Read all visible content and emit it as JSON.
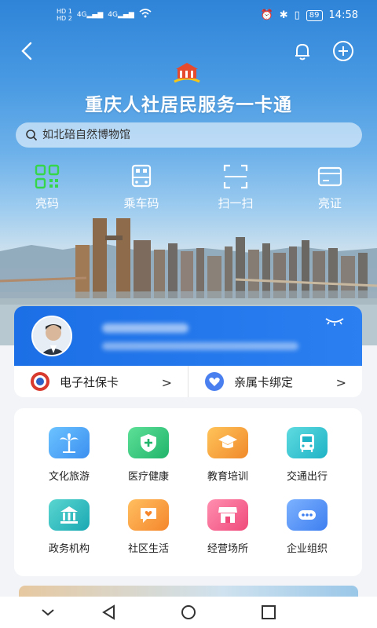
{
  "status_bar": {
    "hd1": "HD 1",
    "hd2": "HD 2",
    "signal1": "4G",
    "signal2": "4G",
    "battery": "89",
    "time": "14:58"
  },
  "header": {
    "title": "重庆人社居民服务一卡通"
  },
  "search": {
    "placeholder": "如北碚自然博物馆"
  },
  "quick_actions": [
    {
      "label": "亮码",
      "icon": "qr-code-icon"
    },
    {
      "label": "乘车码",
      "icon": "bus-code-icon"
    },
    {
      "label": "扫一扫",
      "icon": "scan-icon"
    },
    {
      "label": "亮证",
      "icon": "card-icon"
    }
  ],
  "card_links": [
    {
      "label": "电子社保卡",
      "icon": "social-security-emblem-icon"
    },
    {
      "label": "亲属卡绑定",
      "icon": "heart-icon"
    }
  ],
  "services": [
    {
      "label": "文化旅游",
      "icon": "palm-tree-icon",
      "color": "#4aa8f0"
    },
    {
      "label": "医疗健康",
      "icon": "medical-shield-icon",
      "color": "#36c27a"
    },
    {
      "label": "教育培训",
      "icon": "graduation-cap-icon",
      "color": "#f5a23a"
    },
    {
      "label": "交通出行",
      "icon": "bus-icon",
      "color": "#2fc0d0"
    },
    {
      "label": "政务机构",
      "icon": "government-building-icon",
      "color": "#27b7bd"
    },
    {
      "label": "社区生活",
      "icon": "chat-heart-icon",
      "color": "#f79a3c"
    },
    {
      "label": "经营场所",
      "icon": "store-icon",
      "color": "#f45f8a"
    },
    {
      "label": "企业组织",
      "icon": "more-icon",
      "color": "#4f8ff2"
    }
  ],
  "colors": {
    "accent": "#1c6fe6",
    "qr_green": "#35d64a"
  }
}
